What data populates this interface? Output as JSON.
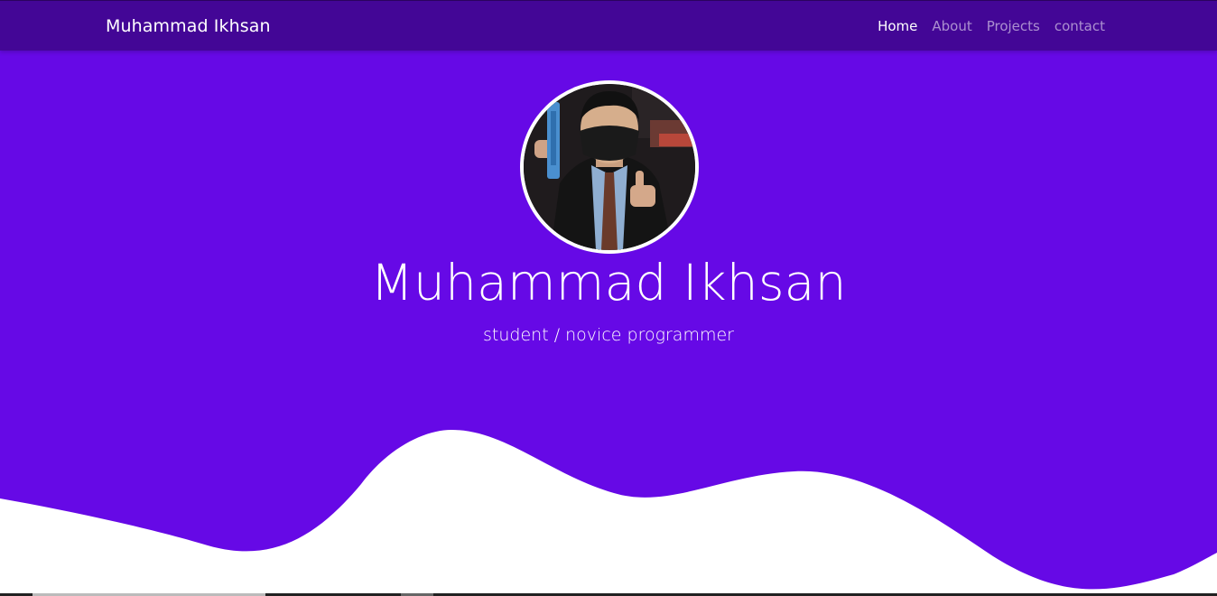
{
  "navbar": {
    "brand": "Muhammad Ikhsan",
    "links": [
      {
        "label": "Home",
        "active": true
      },
      {
        "label": "About",
        "active": false
      },
      {
        "label": "Projects",
        "active": false
      },
      {
        "label": "contact",
        "active": false
      }
    ]
  },
  "hero": {
    "title": "Muhammad Ikhsan",
    "subtitle": "student / novice programmer"
  },
  "colors": {
    "navbar": "#430696",
    "hero": "#6609e6",
    "wave": "#ffffff"
  }
}
